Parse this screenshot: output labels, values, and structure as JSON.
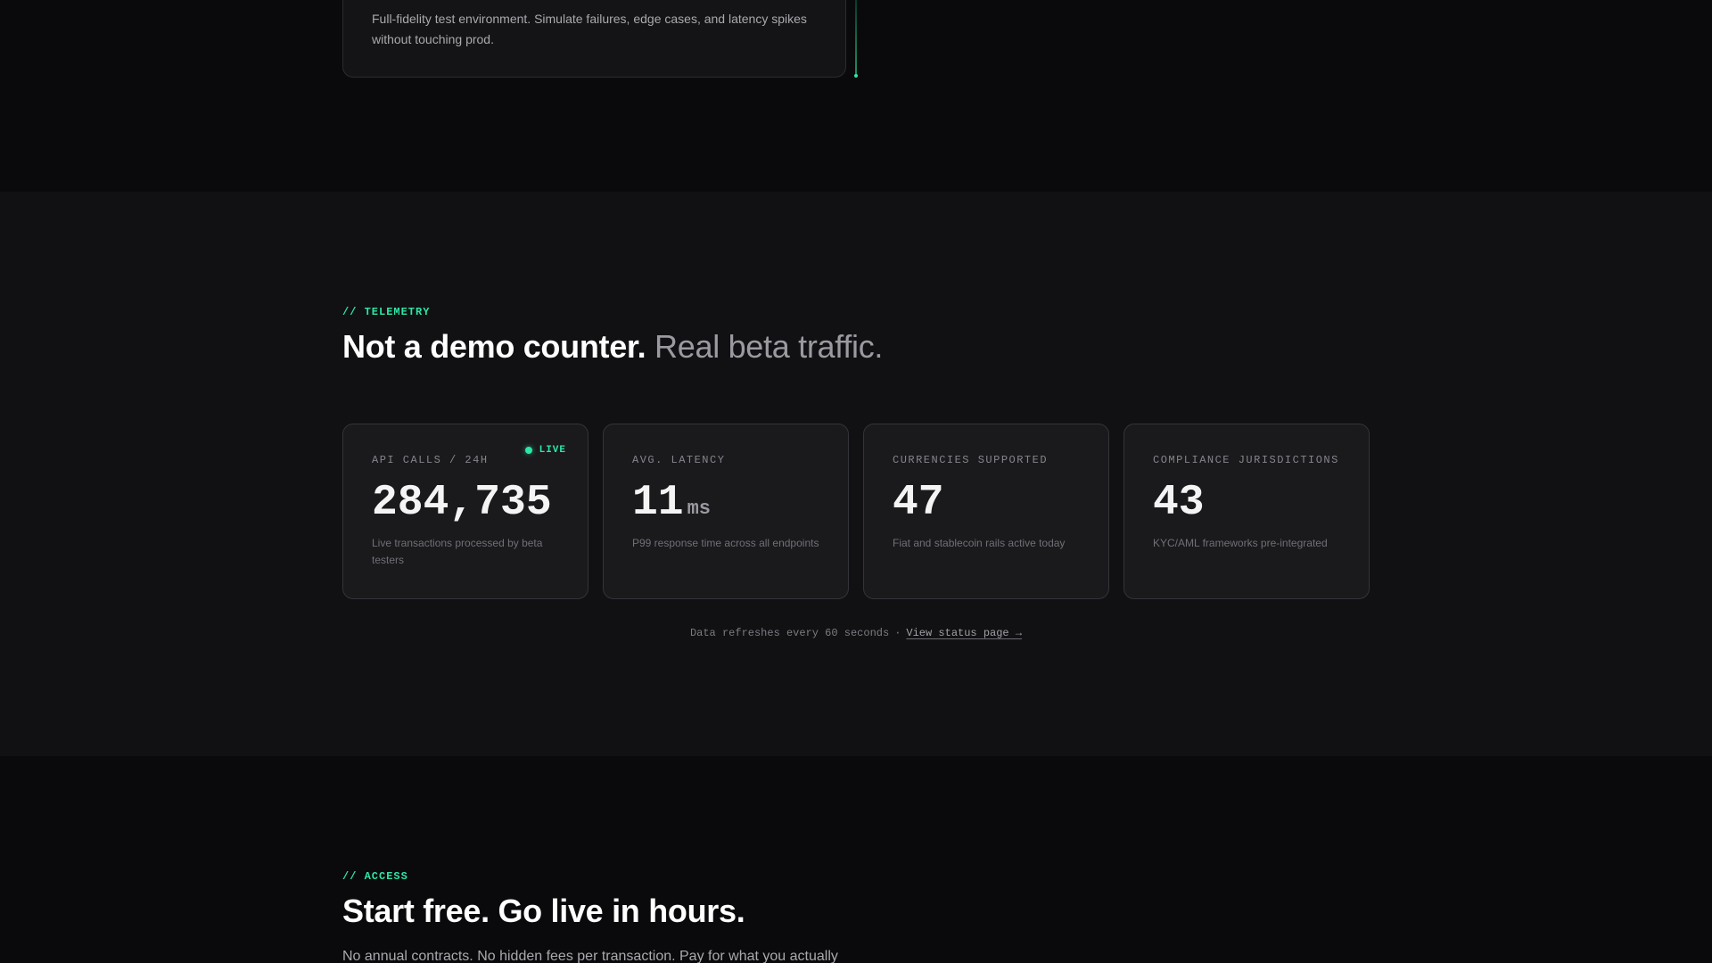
{
  "sandbox": {
    "description": "Full-fidelity test environment. Simulate failures, edge cases, and latency spikes without touching prod."
  },
  "telemetry": {
    "eyebrow": "// TELEMETRY",
    "heading_strong": "Not a demo counter.",
    "heading_muted": "Real beta traffic.",
    "stats": [
      {
        "label": "API CALLS / 24H",
        "value": "284,735",
        "unit": "",
        "sub": "Live transactions processed by beta testers",
        "badge": "LIVE"
      },
      {
        "label": "AVG. LATENCY",
        "value": "11",
        "unit": "ms",
        "sub": "P99 response time across all endpoints"
      },
      {
        "label": "CURRENCIES SUPPORTED",
        "value": "47",
        "unit": "",
        "sub": "Fiat and stablecoin rails active today"
      },
      {
        "label": "COMPLIANCE JURISDICTIONS",
        "value": "43",
        "unit": "",
        "sub": "KYC/AML frameworks pre-integrated"
      }
    ],
    "refresh_note": "Data refreshes every 60 seconds",
    "separator": "·",
    "status_link": "View status page →"
  },
  "access": {
    "eyebrow": "// ACCESS",
    "heading": "Start free. Go live in hours.",
    "lead": "No annual contracts. No hidden fees per transaction. Pay for what you actually"
  },
  "colors": {
    "accent": "#2ee6a6",
    "background": "#0a0a0c",
    "section_background": "#111113",
    "card_background": "#1a1a1d"
  },
  "icons": {
    "live_indicator": "live-dot-icon"
  }
}
